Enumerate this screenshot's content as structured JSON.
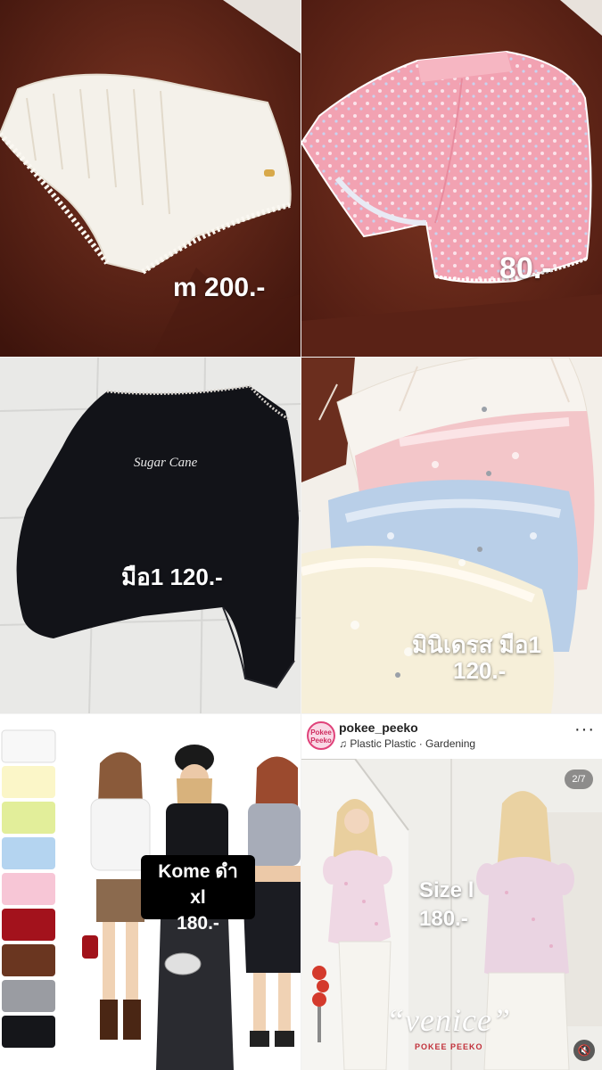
{
  "tiles": {
    "t1": {
      "price": "m 200.-"
    },
    "t2": {
      "price": "80.-"
    },
    "t3": {
      "price": "มือ1 120.-"
    },
    "t4": {
      "line1": "มินิเดรส มือ1",
      "line2": "120.-"
    },
    "t5": {
      "line1": "Kome ดำ xl",
      "line2": "180.-"
    },
    "t6": {
      "username": "pokee_peeko",
      "avatar_text": "Pokee Peeko",
      "music": "Plastic Plastic · Gardening",
      "music_icon": "music-note-icon",
      "more_icon": "more-dots-icon",
      "counter": "2/7",
      "size_label": "Size l",
      "price": "180.-",
      "watermark": "“venice”",
      "brand": "POKEE PEEKO",
      "mute_icon": "speaker-muted-icon"
    }
  },
  "colors": {
    "sofa_brown": "#5a2216",
    "ig_avatar_ring": "#e0427a",
    "price_text": "#ffffff",
    "label_box": "#000000"
  }
}
